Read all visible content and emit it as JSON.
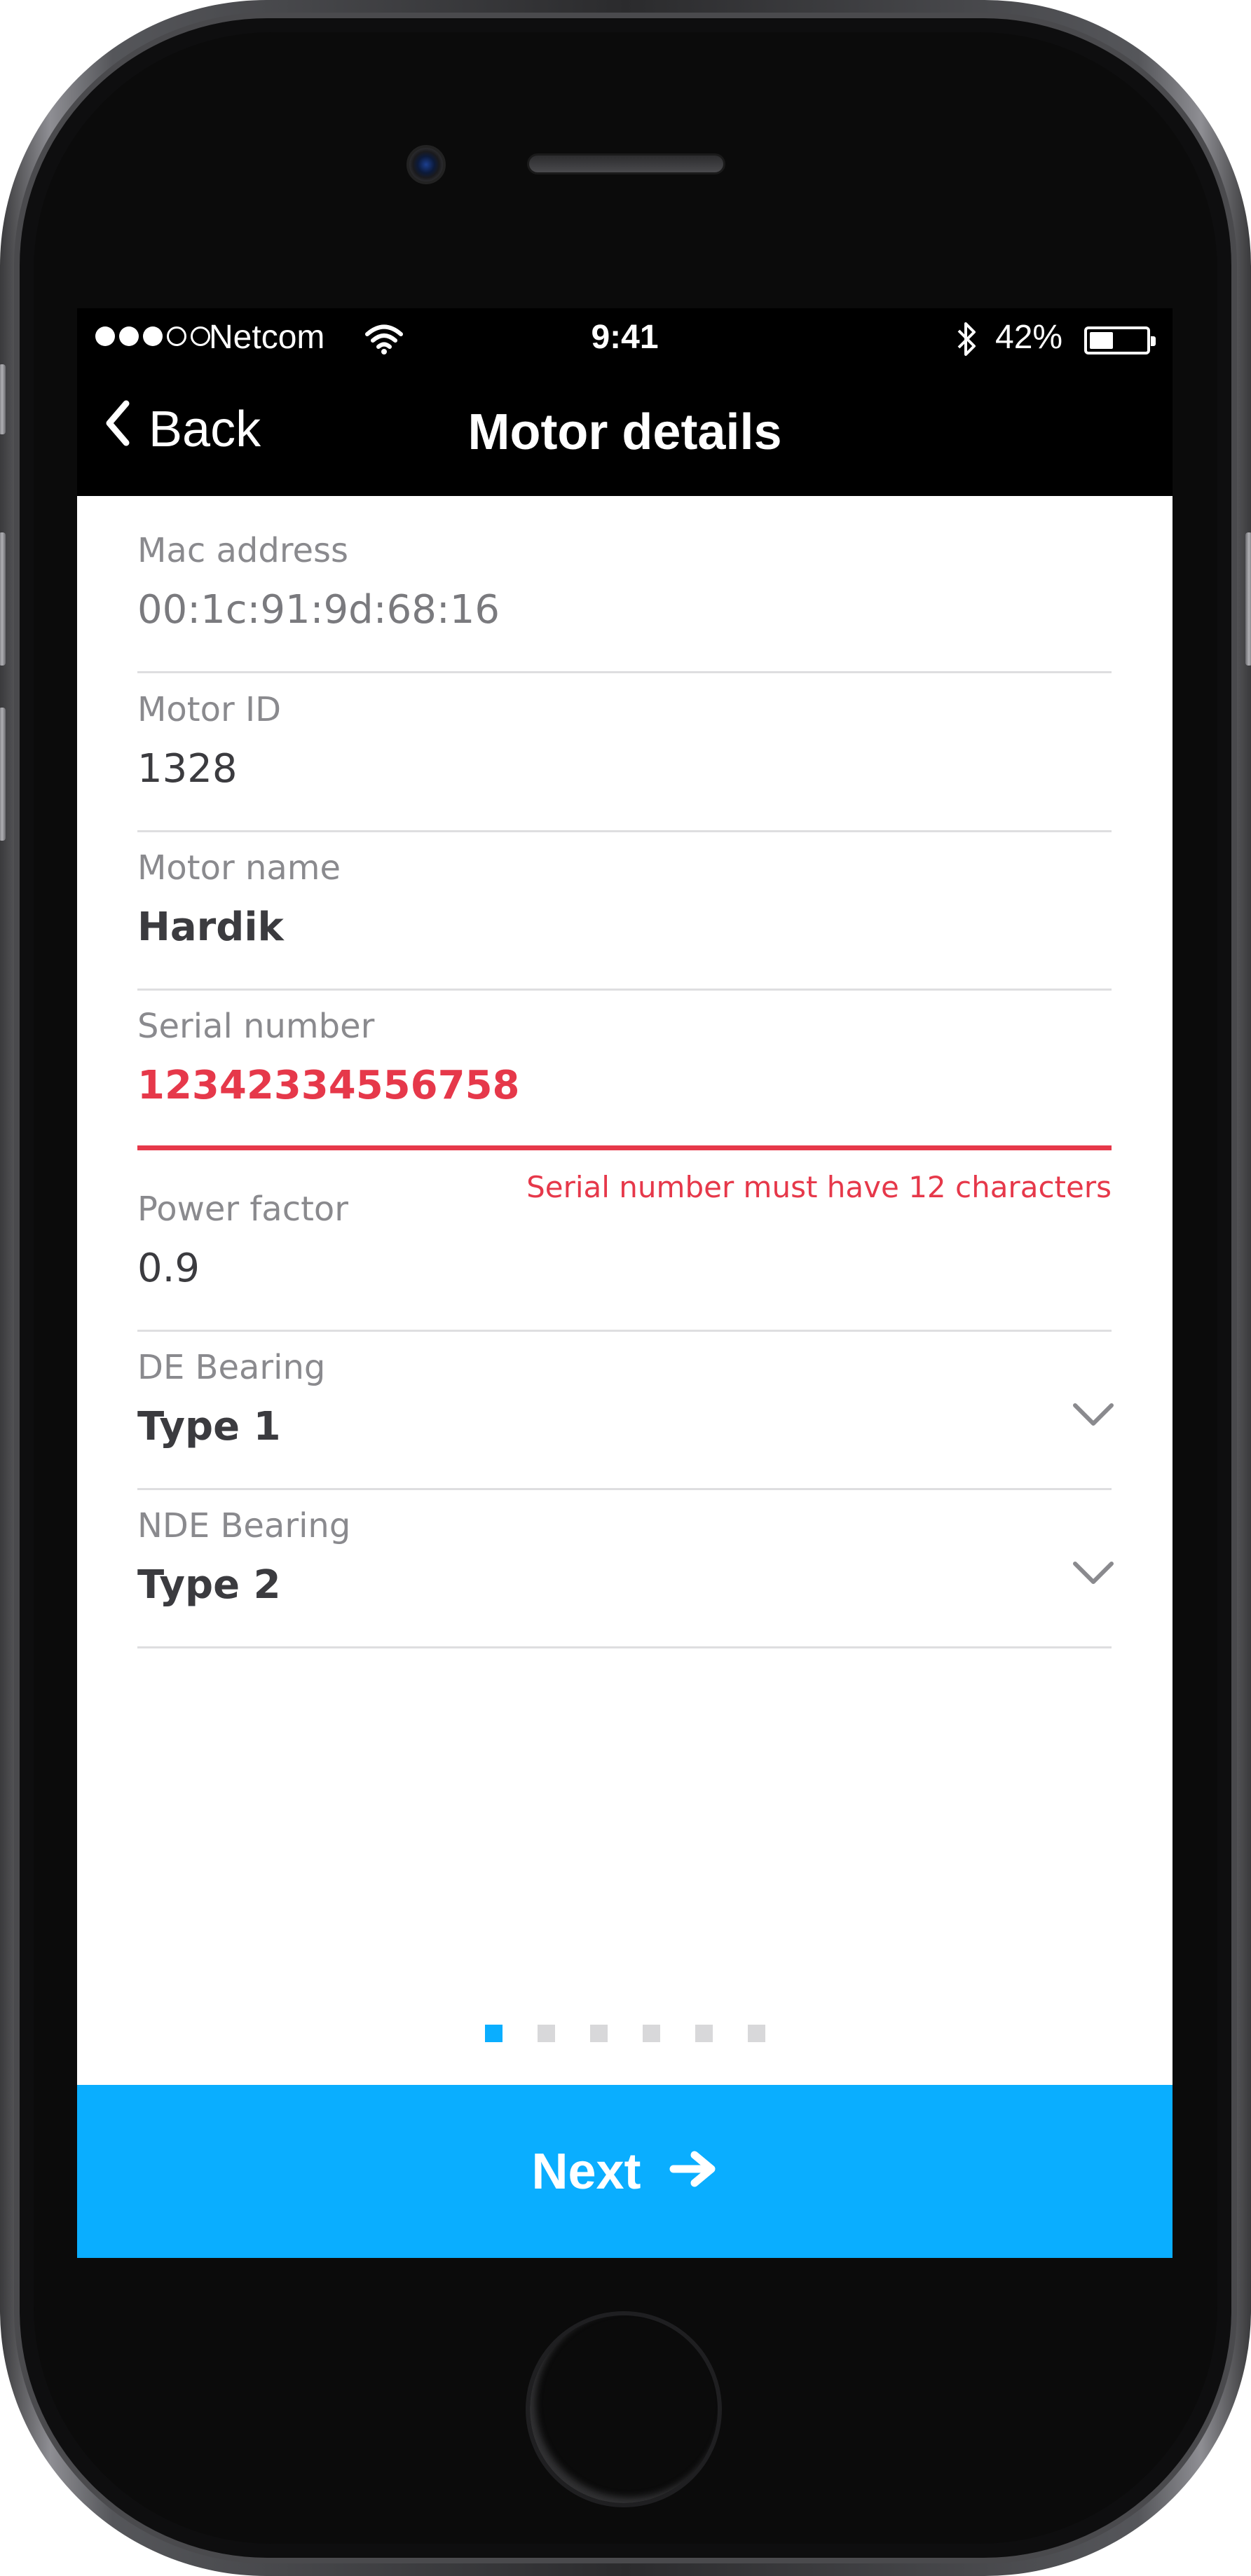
{
  "status_bar": {
    "carrier": "Netcom",
    "time": "9:41",
    "battery_percent": "42%",
    "battery_level": 0.42,
    "signal_bars": 3,
    "signal_total": 5
  },
  "nav": {
    "back_label": "Back",
    "title": "Motor details"
  },
  "form": {
    "fields": [
      {
        "label": "Mac address",
        "value": "00:1c:91:9d:68:16",
        "readonly": true
      },
      {
        "label": "Motor ID",
        "value": "1328"
      },
      {
        "label": "Motor name",
        "value": "Hardik"
      },
      {
        "label": "Serial number",
        "value": "12342334556758",
        "error": "Serial number must have 12 characters"
      },
      {
        "label": "Power factor",
        "value": "0.9"
      },
      {
        "label": "DE Bearing",
        "value": "Type 1",
        "type": "select"
      },
      {
        "label": "NDE Bearing",
        "value": "Type 2",
        "type": "select"
      }
    ]
  },
  "pager": {
    "total_pages": 6,
    "current_page": 1
  },
  "next_button": {
    "label": "Next"
  },
  "colors": {
    "accent": "#0aaeff",
    "error": "#e6384a",
    "nav_background": "#000000"
  }
}
